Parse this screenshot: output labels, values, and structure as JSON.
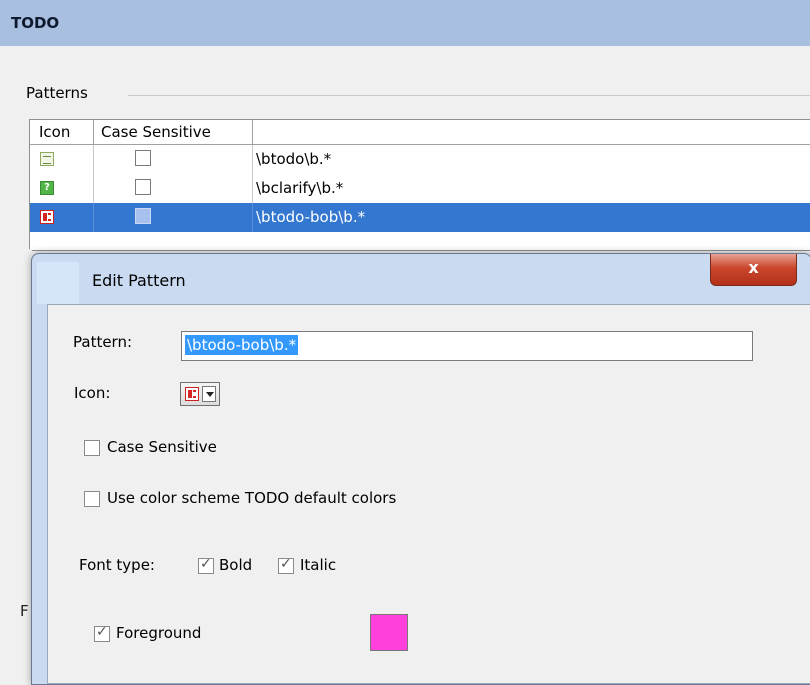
{
  "header": {
    "title": "TODO"
  },
  "patterns": {
    "section_label": "Patterns",
    "columns": {
      "icon": "Icon",
      "case_sensitive": "Case Sensitive",
      "pattern": ""
    },
    "rows": [
      {
        "icon": "todo-note-icon",
        "case_sensitive": false,
        "pattern": "\\btodo\\b.*",
        "selected": false
      },
      {
        "icon": "clarify-question-icon",
        "case_sensitive": false,
        "pattern": "\\bclarify\\b.*",
        "selected": false
      },
      {
        "icon": "important-red-icon",
        "case_sensitive": false,
        "pattern": "\\btodo-bob\\b.*",
        "selected": true
      }
    ]
  },
  "background": {
    "partial_label": "F"
  },
  "dialog": {
    "title": "Edit Pattern",
    "close_label": "x",
    "pattern_label": "Pattern:",
    "pattern_value": "\\btodo-bob\\b.*",
    "icon_label": "Icon:",
    "icon_value": "important-red-icon",
    "case_sensitive_label": "Case Sensitive",
    "case_sensitive_checked": false,
    "use_default_colors_label": "Use color scheme TODO default colors",
    "use_default_colors_checked": false,
    "font_type_label": "Font type:",
    "bold_label": "Bold",
    "bold_checked": true,
    "italic_label": "Italic",
    "italic_checked": true,
    "foreground_label": "Foreground",
    "foreground_checked": true,
    "foreground_color": "#ff40dd"
  },
  "colors": {
    "header_bg": "#a9bfe0",
    "selection": "#3477d0",
    "dialog_frame": "#c9daf1",
    "close_button": "#c9462b"
  }
}
